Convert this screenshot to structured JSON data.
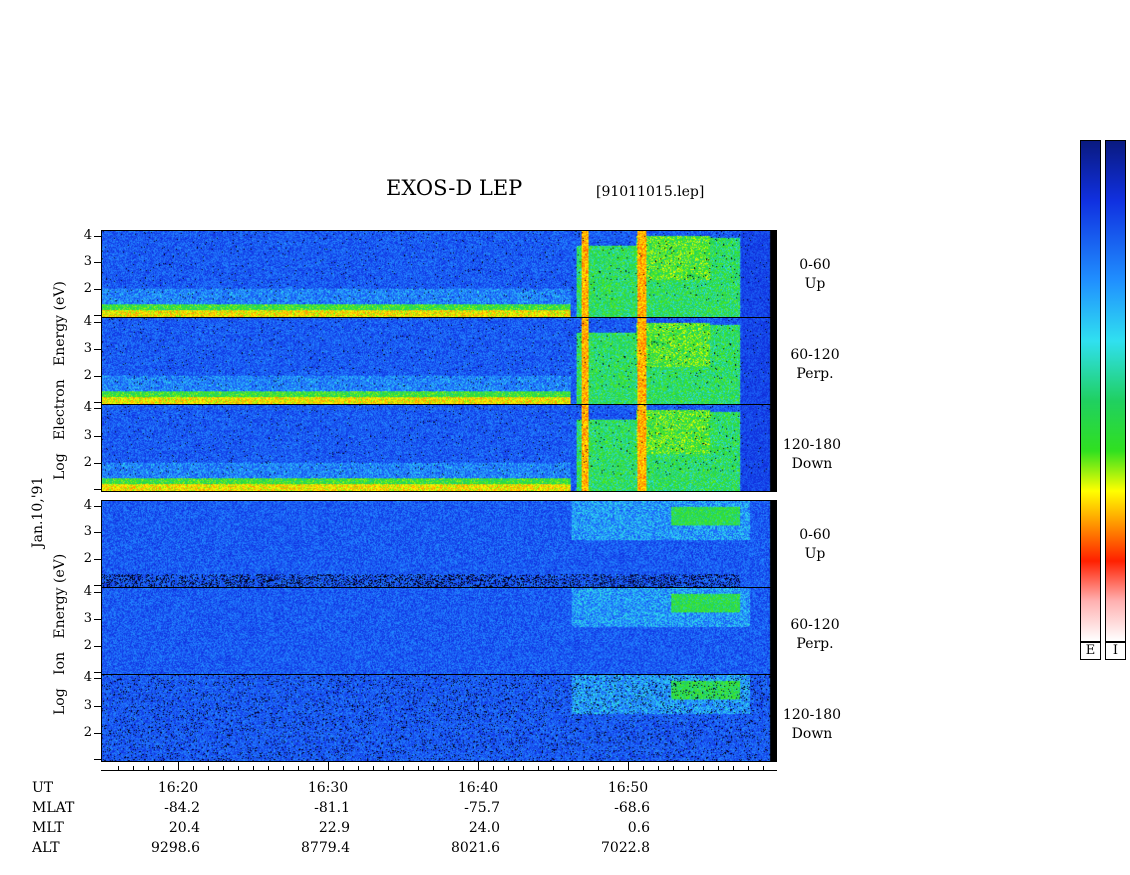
{
  "header": {
    "title": "EXOS-D LEP",
    "file_id": "[91011015.lep]"
  },
  "date_label": "Jan.10,'91",
  "electron": {
    "axis_label_words": [
      "Log",
      "Electron",
      "Energy",
      "(eV)"
    ],
    "panels": [
      {
        "angle": "0-60",
        "direction": "Up",
        "yticks": [
          "4",
          "3",
          "2"
        ]
      },
      {
        "angle": "60-120",
        "direction": "Perp.",
        "yticks": [
          "4",
          "3",
          "2"
        ]
      },
      {
        "angle": "120-180",
        "direction": "Down",
        "yticks": [
          "4",
          "3",
          "2"
        ]
      }
    ]
  },
  "ion": {
    "axis_label_words": [
      "Log",
      "Ion",
      "Energy",
      "(eV)"
    ],
    "panels": [
      {
        "angle": "0-60",
        "direction": "Up",
        "yticks": [
          "4",
          "3",
          "2"
        ]
      },
      {
        "angle": "60-120",
        "direction": "Perp.",
        "yticks": [
          "4",
          "3",
          "2"
        ]
      },
      {
        "angle": "120-180",
        "direction": "Down",
        "yticks": [
          "4",
          "3",
          "2"
        ]
      }
    ]
  },
  "colorbar_labels": [
    "E",
    "I"
  ],
  "chart_data": {
    "type": "heatmap",
    "title": "EXOS-D LEP",
    "subtitle": "[91011015.lep]",
    "x_ticks": [
      "16:20",
      "16:30",
      "16:40",
      "16:50"
    ],
    "ylabel_electron": "Log Electron Energy (eV)",
    "ylabel_ion": "Log Ion Energy (eV)",
    "y_ticks": [
      4,
      3,
      2
    ],
    "ylim": [
      1,
      4.2
    ],
    "panels": [
      "Electron 0-60 Up",
      "Electron 60-120 Perp.",
      "Electron 120-180 Down",
      "Ion 0-60 Up",
      "Ion 60-120 Perp.",
      "Ion 120-180 Down"
    ],
    "colorbar": [
      "E",
      "I"
    ]
  },
  "orbit_table": {
    "rows": [
      {
        "name": "UT",
        "values": [
          "16:20",
          "16:30",
          "16:40",
          "16:50"
        ]
      },
      {
        "name": "MLAT",
        "values": [
          "-84.2",
          "-81.1",
          "-75.7",
          "-68.6"
        ]
      },
      {
        "name": "MLT",
        "values": [
          "20.4",
          "22.9",
          "24.0",
          "0.6"
        ]
      },
      {
        "name": "ALT",
        "values": [
          "9298.6",
          "8779.4",
          "8021.6",
          "7022.8"
        ]
      }
    ]
  },
  "colors": {
    "background": "#0a2fd8"
  }
}
